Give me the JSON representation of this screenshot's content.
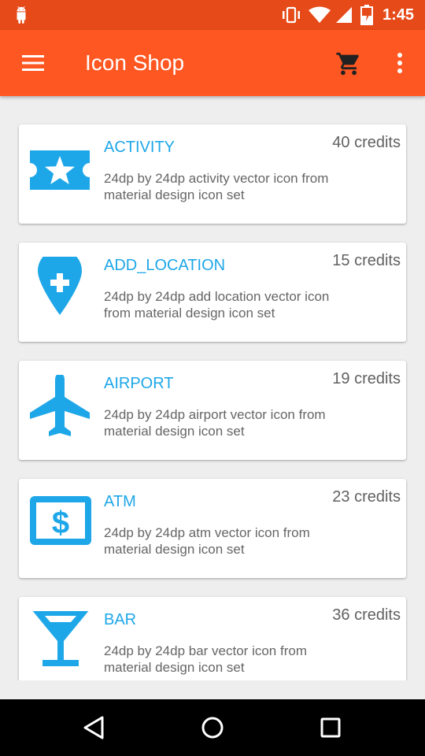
{
  "status_bar": {
    "time": "1:45",
    "icons": [
      "android-debug-icon",
      "vibrate-icon",
      "wifi-icon",
      "signal-icon",
      "battery-charging-icon"
    ]
  },
  "app_bar": {
    "title": "Icon Shop",
    "icons": [
      "menu-icon",
      "cart-icon",
      "more-vert-icon"
    ]
  },
  "colors": {
    "status_bar": "#e64a19",
    "app_bar": "#ff5722",
    "accent": "#1ea7e8",
    "background": "#eeeeee"
  },
  "items": [
    {
      "name": "ACTIVITY",
      "credits": "40 credits",
      "description": "24dp by 24dp activity vector icon from material design icon set",
      "icon": "activity-ticket-star-icon"
    },
    {
      "name": "ADD_LOCATION",
      "credits": "15 credits",
      "description": "24dp by 24dp add location vector icon from material design icon set",
      "icon": "add-location-pin-icon"
    },
    {
      "name": "AIRPORT",
      "credits": "19 credits",
      "description": "24dp by 24dp airport vector icon from material design icon set",
      "icon": "airplane-icon"
    },
    {
      "name": "ATM",
      "credits": "23 credits",
      "description": "24dp by 24dp atm vector icon from material design icon set",
      "icon": "atm-dollar-icon"
    },
    {
      "name": "BAR",
      "credits": "36 credits",
      "description": "24dp by 24dp bar vector icon from material design icon set",
      "icon": "cocktail-glass-icon"
    }
  ],
  "nav_bar": {
    "icons": [
      "back-icon",
      "home-icon",
      "recents-icon"
    ]
  }
}
